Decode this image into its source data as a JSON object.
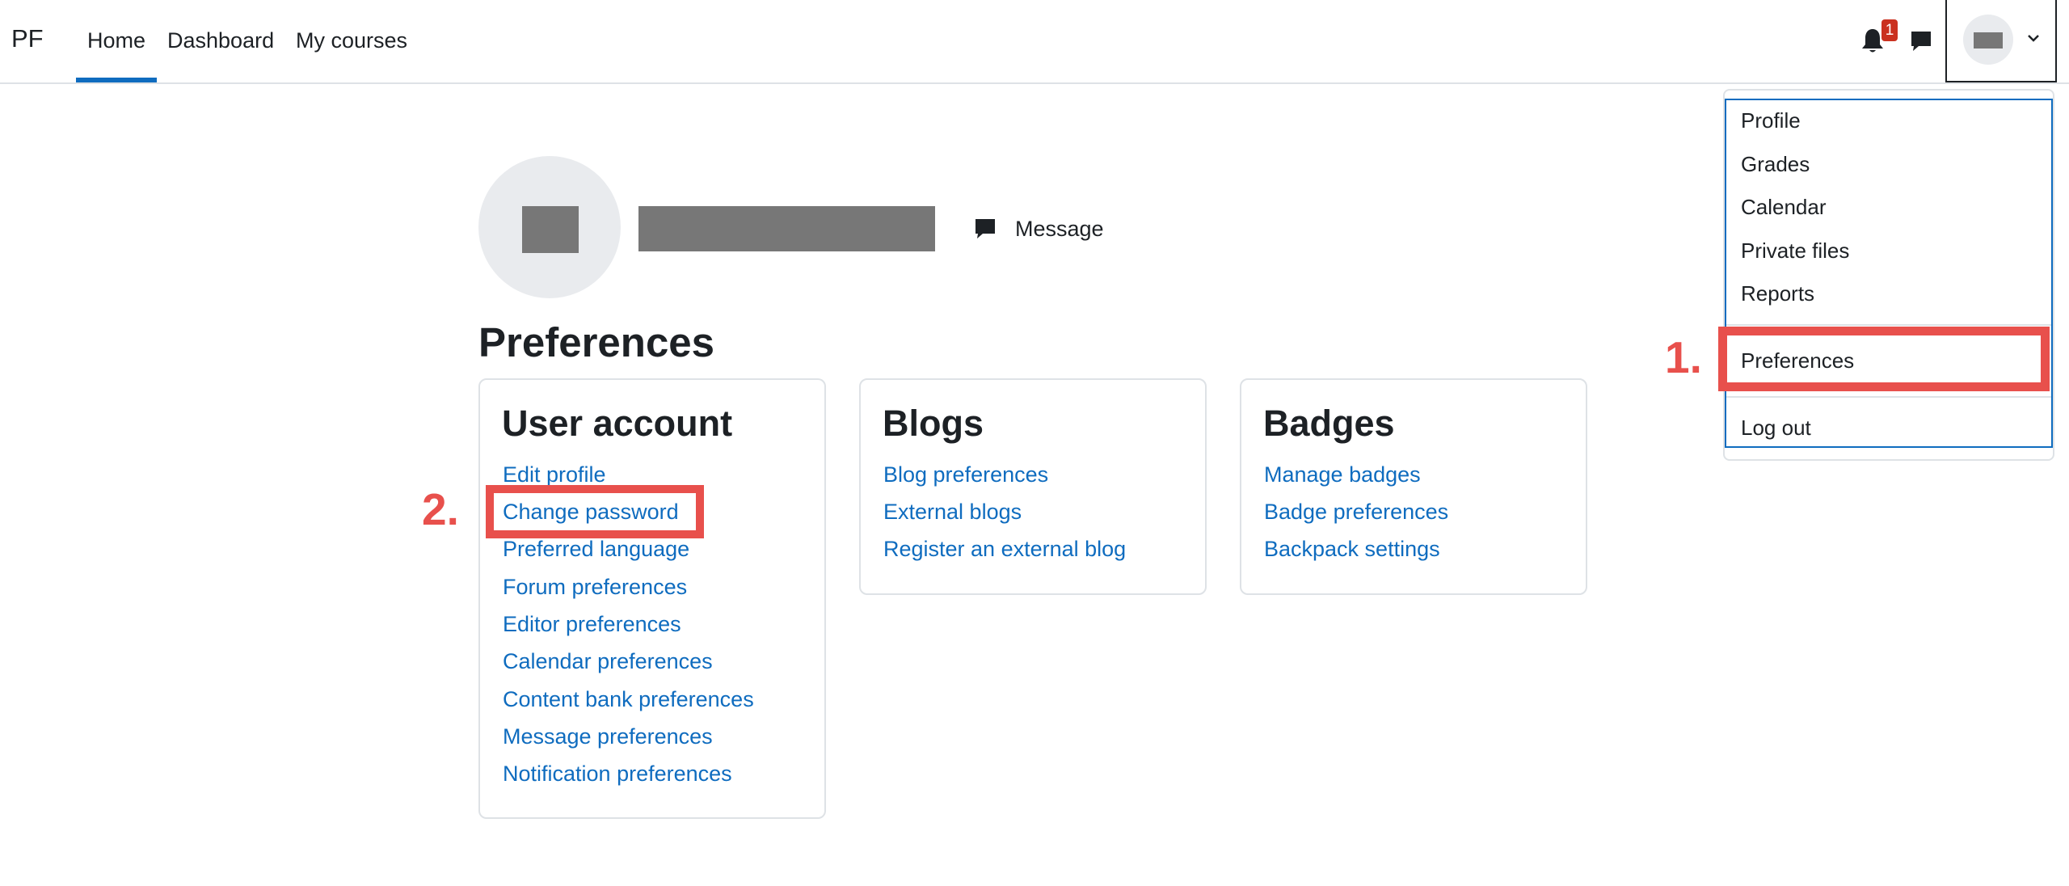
{
  "navbar": {
    "brand": "PF",
    "links": [
      "Home",
      "Dashboard",
      "My courses"
    ],
    "active": "Home",
    "notification_count": "1"
  },
  "user_menu": {
    "items": [
      "Profile",
      "Grades",
      "Calendar",
      "Private files",
      "Reports",
      "Preferences",
      "Log out"
    ]
  },
  "profile": {
    "message_label": "Message"
  },
  "page": {
    "title": "Preferences"
  },
  "cards": {
    "user_account": {
      "title": "User account",
      "links": [
        "Edit profile",
        "Change password",
        "Preferred language",
        "Forum preferences",
        "Editor preferences",
        "Calendar preferences",
        "Content bank preferences",
        "Message preferences",
        "Notification preferences"
      ]
    },
    "blogs": {
      "title": "Blogs",
      "links": [
        "Blog preferences",
        "External blogs",
        "Register an external blog"
      ]
    },
    "badges": {
      "title": "Badges",
      "links": [
        "Manage badges",
        "Badge preferences",
        "Backpack settings"
      ]
    }
  },
  "annotations": {
    "step1": "1.",
    "step2": "2."
  },
  "colors": {
    "link": "#0f6cbf",
    "highlight": "#e8504c",
    "badge": "#ca3120"
  }
}
